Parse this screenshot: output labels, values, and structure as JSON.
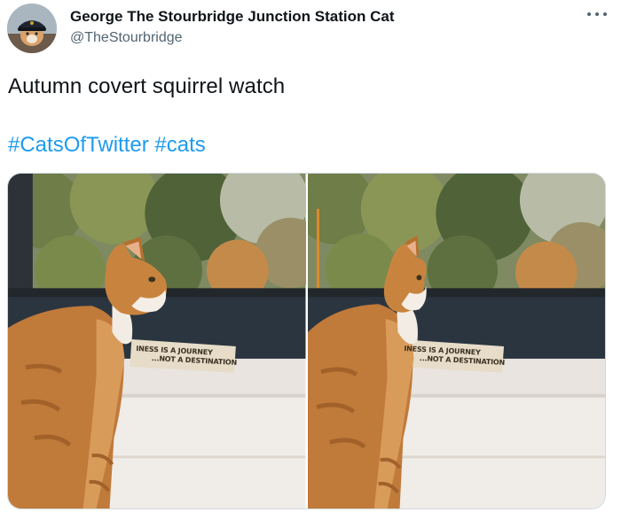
{
  "author": {
    "display_name": "George The Stourbridge Junction Station Cat",
    "handle": "@TheStourbridge"
  },
  "tweet": {
    "text": "Autumn covert squirrel watch",
    "hashtags": [
      "#CatsOfTwitter",
      "#cats"
    ]
  },
  "media": {
    "photos": [
      {
        "plaque_line1": "INESS IS A JOURNEY",
        "plaque_line2": "...NOT A DESTINATION"
      },
      {
        "plaque_line1": "INESS IS A JOURNEY",
        "plaque_line2": "...NOT A DESTINATION"
      }
    ]
  },
  "colors": {
    "link": "#1d9bf0",
    "secondary_text": "#536471",
    "primary_text": "#0f1419",
    "border": "#cfd9de"
  },
  "icons": {
    "more_menu": "more-horizontal-icon"
  }
}
